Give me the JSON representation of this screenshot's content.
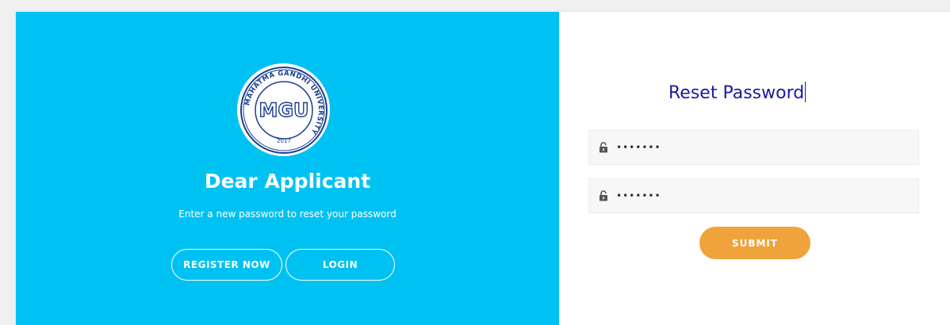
{
  "logo": {
    "text": "MGU",
    "ring_text": "MAHATMA GANDHI UNIVERSITY",
    "year": "2017"
  },
  "left": {
    "title": "Dear Applicant",
    "subtitle": "Enter a new password to reset your password",
    "register_label": "REGISTER NOW",
    "login_label": "LOGIN"
  },
  "right": {
    "title": "Reset Password",
    "new_password_value": "•••••••",
    "confirm_password_value": "•••••••",
    "submit_label": "SUBMIT"
  },
  "colors": {
    "left_panel_bg": "#00c2f2",
    "title_blue": "#1a1aa0",
    "submit_orange": "#f0a33a"
  },
  "icons": {
    "lock": "lock-icon"
  }
}
